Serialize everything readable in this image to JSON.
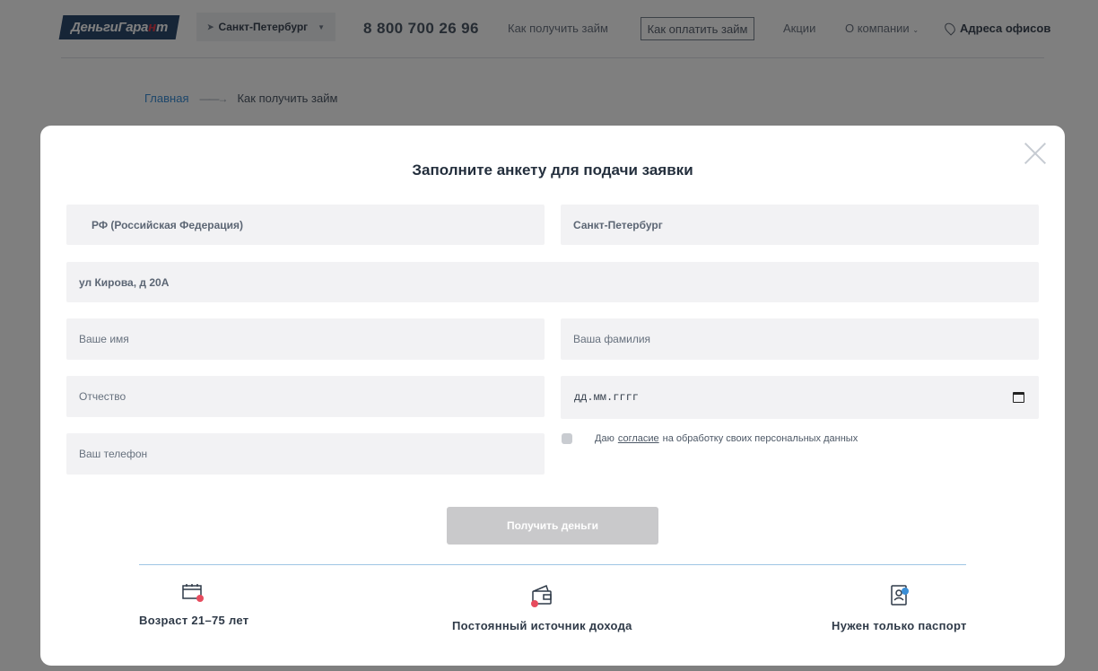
{
  "header": {
    "logo_main": "Деньги",
    "logo_second": "Гара",
    "logo_accent": "н",
    "logo_end": "т",
    "city": "Санкт-Петербург",
    "phone": "8 800 700 26 96",
    "nav": {
      "how_to_get": "Как получить займ",
      "how_to_pay": "Как оплатить займ",
      "promos": "Акции",
      "about": "О компании",
      "offices": "Адреса офисов"
    }
  },
  "breadcrumb": {
    "home": "Главная",
    "separator": "——→",
    "current": "Как получить займ"
  },
  "modal": {
    "title": "Заполните анкету для подачи заявки",
    "fields": {
      "country": "РФ (Российская Федерация)",
      "city": "Санкт-Петербург",
      "address": "ул Кирова, д 20А",
      "first_name_placeholder": "Ваше имя",
      "last_name_placeholder": "Ваша фамилия",
      "patronymic_placeholder": "Отчество",
      "birthdate_placeholder": "дд.мм.гггг",
      "phone_placeholder": "Ваш телефон"
    },
    "consent": {
      "before": "Даю",
      "link": "согласие",
      "after": "на обработку своих персональных данных"
    },
    "submit_label": "Получить деньги",
    "features": [
      {
        "label": "Возраст 21–75 лет",
        "icon": "calendar-icon"
      },
      {
        "label": "Постоянный источник дохода",
        "icon": "wallet-icon"
      },
      {
        "label": "Нужен только паспорт",
        "icon": "passport-icon"
      }
    ]
  },
  "colors": {
    "accent_red": "#e74c5e",
    "accent_blue": "#3b8ed6",
    "logo_bg": "#2d4a6e",
    "button_disabled": "#c9c9cb",
    "divider": "#9fc6e4"
  }
}
